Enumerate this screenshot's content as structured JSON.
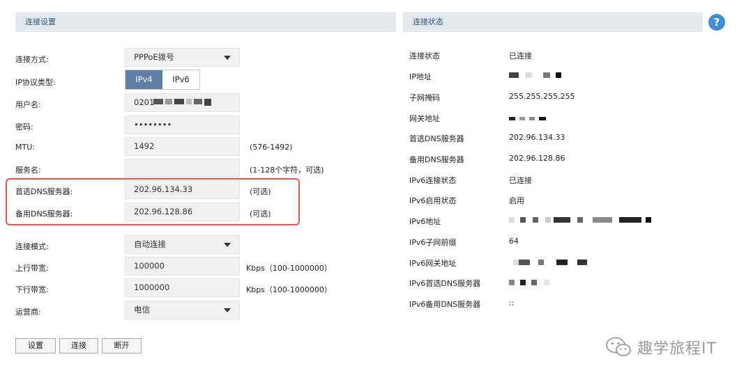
{
  "left_panel": {
    "title": "连接设置",
    "rows": {
      "conn_method": {
        "label": "连接方式:",
        "value": "PPPoE拨号"
      },
      "ip_type": {
        "label": "IP协议类型:",
        "option_ipv4": "IPv4",
        "option_ipv6": "IPv6",
        "selected": "IPv4"
      },
      "username": {
        "label": "用户名:",
        "value": "0201"
      },
      "password": {
        "label": "密码:",
        "value": "••••••••"
      },
      "mtu": {
        "label": "MTU:",
        "value": "1492",
        "hint": "(576-1492)"
      },
      "service": {
        "label": "服务名:",
        "value": "",
        "hint": "(1-128个字符，可选)"
      },
      "dns1": {
        "label": "首选DNS服务器:",
        "value": "202.96.134.33",
        "hint": "(可选)"
      },
      "dns2": {
        "label": "备用DNS服务器:",
        "value": "202.96.128.86",
        "hint": "(可选)"
      },
      "conn_mode": {
        "label": "连接模式:",
        "value": "自动连接"
      },
      "upload": {
        "label": "上行带宽:",
        "value": "100000",
        "hint": "Kbps（100-1000000）"
      },
      "download": {
        "label": "下行带宽:",
        "value": "1000000",
        "hint": "Kbps（100-1000000）"
      },
      "isp": {
        "label": "运营商:",
        "value": "电信"
      }
    },
    "buttons": {
      "settings": "设置",
      "connect": "连接",
      "disconnect": "断开"
    }
  },
  "right_panel": {
    "title": "连接状态",
    "help_icon": "?",
    "rows": [
      {
        "label": "连接状态",
        "value": "已连接"
      },
      {
        "label": "IP地址",
        "value": ""
      },
      {
        "label": "子网掩码",
        "value": "255.255.255.255"
      },
      {
        "label": "网关地址",
        "value": ""
      },
      {
        "label": "首选DNS服务器",
        "value": "202.96.134.33"
      },
      {
        "label": "备用DNS服务器",
        "value": "202.96.128.86"
      },
      {
        "label": "IPv6连接状态",
        "value": "已连接"
      },
      {
        "label": "IPv6启用状态",
        "value": "启用"
      },
      {
        "label": "IPv6地址",
        "value": ""
      },
      {
        "label": "IPv6子网前缀",
        "value": "64"
      },
      {
        "label": "IPv6网关地址",
        "value": ""
      },
      {
        "label": "IPv6首选DNS服务器",
        "value": ""
      },
      {
        "label": "IPv6备用DNS服务器",
        "value": "::"
      }
    ]
  },
  "watermark": {
    "text": "趣学旅程IT",
    "icon": "wechat-icon"
  },
  "colors": {
    "accent": "#5f7ea6",
    "header_bg": "#e4e9ef",
    "highlight": "#e2564c",
    "help": "#3d8fd6"
  }
}
